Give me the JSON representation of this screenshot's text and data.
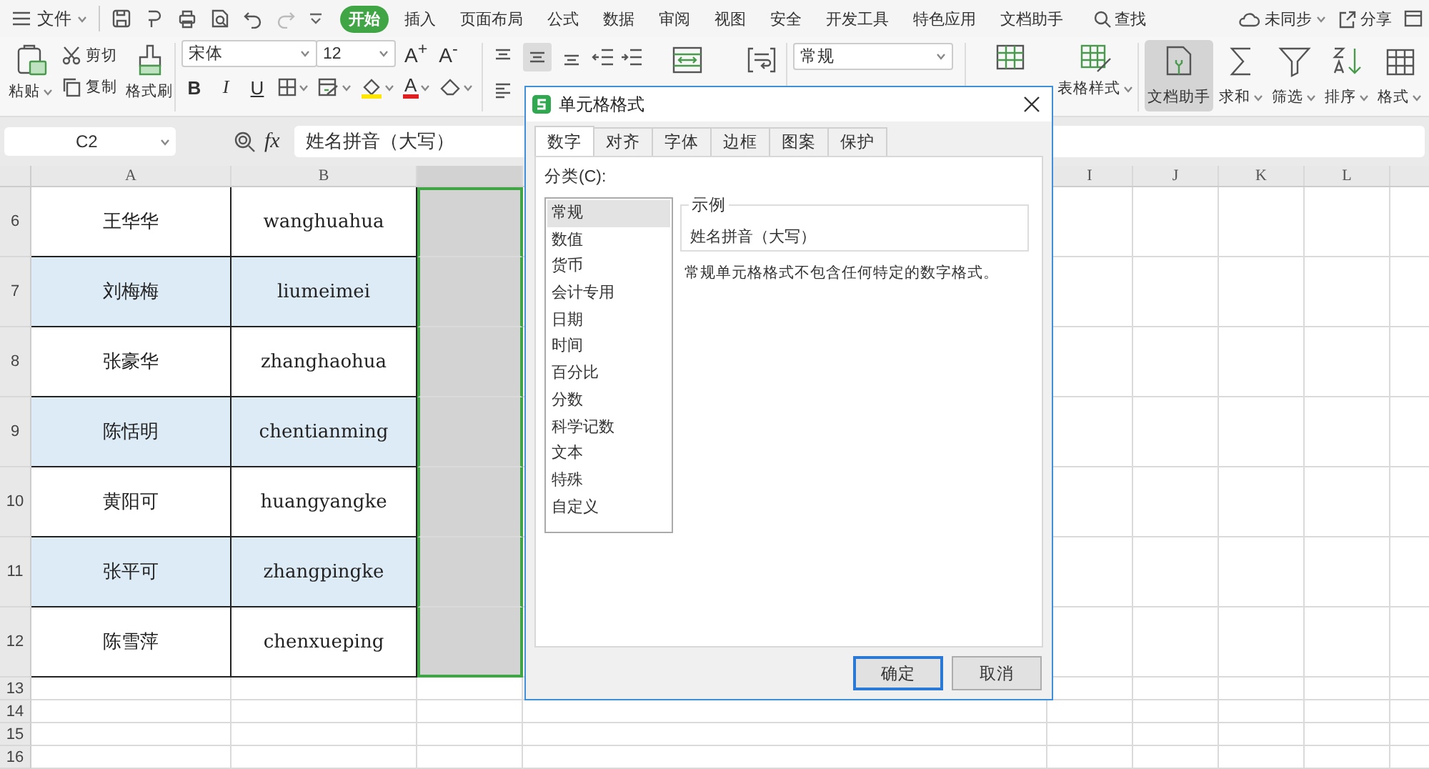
{
  "menu_bar": {
    "file_menu": "文件",
    "tabs": [
      {
        "label": "开始",
        "selected": true
      },
      {
        "label": "插入",
        "selected": false
      },
      {
        "label": "页面布局",
        "selected": false
      },
      {
        "label": "公式",
        "selected": false
      },
      {
        "label": "数据",
        "selected": false
      },
      {
        "label": "审阅",
        "selected": false
      },
      {
        "label": "视图",
        "selected": false
      },
      {
        "label": "安全",
        "selected": false
      },
      {
        "label": "开发工具",
        "selected": false
      },
      {
        "label": "特色应用",
        "selected": false
      },
      {
        "label": "文档助手",
        "selected": false
      }
    ],
    "search": "查找",
    "sync": "未同步",
    "share": "分享"
  },
  "ribbon": {
    "paste": "粘贴",
    "cut": "剪切",
    "copy": "复制",
    "format_painter": "格式刷",
    "font_name": "宋体",
    "font_size": "12",
    "grow_font": "A$^{+}$",
    "shrink_font": "A$^{-}$",
    "style_buttons": [
      {
        "label": "B",
        "kind": "bold"
      },
      {
        "label": "I",
        "kind": "italic"
      },
      {
        "label": "U",
        "kind": "underline"
      }
    ],
    "font_color": "A",
    "align_buttons": [
      {
        "selected": false
      },
      {
        "selected": true
      },
      {
        "selected": false
      }
    ],
    "number_format": "常规",
    "table_style": "表格样式",
    "tools": [
      {
        "label": "文档助手",
        "selected": true,
        "dropdown": false
      },
      {
        "label": "求和",
        "selected": false,
        "dropdown": true
      },
      {
        "label": "筛选",
        "selected": false,
        "dropdown": true
      },
      {
        "label": "排序",
        "selected": false,
        "dropdown": true
      },
      {
        "label": "格式",
        "selected": false,
        "dropdown": true
      }
    ]
  },
  "formula_bar": {
    "cell_ref": "C2",
    "fx": "fx",
    "value": "姓名拼音（大写）"
  },
  "sheet": {
    "columns_left": [
      "A",
      "B"
    ],
    "columns_right": [
      "I",
      "J",
      "K",
      "L"
    ],
    "rows": [
      {
        "number": "6",
        "name": "王华华",
        "pinyin": "wanghuahua",
        "shaded": false,
        "c_selected": true
      },
      {
        "number": "7",
        "name": "刘梅梅",
        "pinyin": "liumeimei",
        "shaded": true,
        "c_selected": true
      },
      {
        "number": "8",
        "name": "张豪华",
        "pinyin": "zhanghaohua",
        "shaded": false,
        "c_selected": true
      },
      {
        "number": "9",
        "name": "陈恬明",
        "pinyin": "chentianming",
        "shaded": true,
        "c_selected": true
      },
      {
        "number": "10",
        "name": "黄阳可",
        "pinyin": "huangyangke",
        "shaded": false,
        "c_selected": true
      },
      {
        "number": "11",
        "name": "张平可",
        "pinyin": "zhangpingke",
        "shaded": true,
        "c_selected": true
      },
      {
        "number": "12",
        "name": "陈雪萍",
        "pinyin": "chenxueping",
        "shaded": false,
        "c_selected": true
      }
    ],
    "empty_rows": [
      "13",
      "14",
      "15",
      "16"
    ]
  },
  "dialog": {
    "title": "单元格格式",
    "tabs": [
      {
        "label": "数字",
        "selected": true
      },
      {
        "label": "对齐",
        "selected": false
      },
      {
        "label": "字体",
        "selected": false
      },
      {
        "label": "边框",
        "selected": false
      },
      {
        "label": "图案",
        "selected": false
      },
      {
        "label": "保护",
        "selected": false
      }
    ],
    "category_label": "分类(C):",
    "categories": [
      {
        "label": "常规",
        "selected": true
      },
      {
        "label": "数值",
        "selected": false
      },
      {
        "label": "货币",
        "selected": false
      },
      {
        "label": "会计专用",
        "selected": false
      },
      {
        "label": "日期",
        "selected": false
      },
      {
        "label": "时间",
        "selected": false
      },
      {
        "label": "百分比",
        "selected": false
      },
      {
        "label": "分数",
        "selected": false
      },
      {
        "label": "科学记数",
        "selected": false
      },
      {
        "label": "文本",
        "selected": false
      },
      {
        "label": "特殊",
        "selected": false
      },
      {
        "label": "自定义",
        "selected": false
      }
    ],
    "sample_label": "示例",
    "sample_value": "姓名拼音（大写）",
    "description": "常规单元格格式不包含任何特定的数字格式。",
    "buttons": [
      {
        "label": "确定",
        "default": true
      },
      {
        "label": "取消",
        "default": false
      }
    ]
  }
}
